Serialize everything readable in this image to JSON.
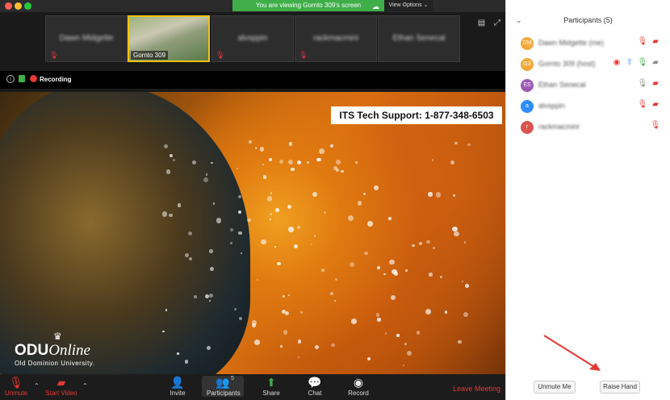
{
  "titlebar": {
    "banner_text": "You are viewing Gornto 309's screen",
    "view_options_label": "View Options",
    "colors": {
      "close": "#ff5f57",
      "minimize": "#febc2e",
      "zoom": "#28c840",
      "banner": "#3fae49"
    }
  },
  "thumbnails": [
    {
      "name": "Dawn Midgette"
    },
    {
      "name": "Gornto 309"
    },
    {
      "name": "alvsppin"
    },
    {
      "name": "rackmacmini"
    },
    {
      "name": "Ethan Senecal"
    }
  ],
  "recording": {
    "label": "Recording"
  },
  "video": {
    "support_banner": "ITS Tech Support: 1-877-348-6503",
    "logo": {
      "odu": "ODU",
      "online": "Online",
      "subtitle": "Old Dominion University."
    }
  },
  "toolbar": {
    "unmute": "Unmute",
    "start_video": "Start Video",
    "invite": "Invite",
    "participants": "Participants",
    "participants_count": "5",
    "share": "Share",
    "chat": "Chat",
    "record": "Record",
    "leave": "Leave Meeting"
  },
  "panel": {
    "title": "Participants (5)",
    "participants": [
      {
        "initials": "DM",
        "name": "Dawn Midgette (me)",
        "color": "#f2a93b"
      },
      {
        "initials": "G3",
        "name": "Gornto 309 (host)",
        "color": "#f2a93b"
      },
      {
        "initials": "ES",
        "name": "Ethan Senecal",
        "color": "#9b59b6"
      },
      {
        "initials": "a",
        "name": "alvsppin",
        "color": "#2d8cff"
      },
      {
        "initials": "r",
        "name": "rackmacmini",
        "color": "#d9534f"
      }
    ],
    "unmute_me": "Unmute Me",
    "raise_hand": "Raise Hand"
  }
}
